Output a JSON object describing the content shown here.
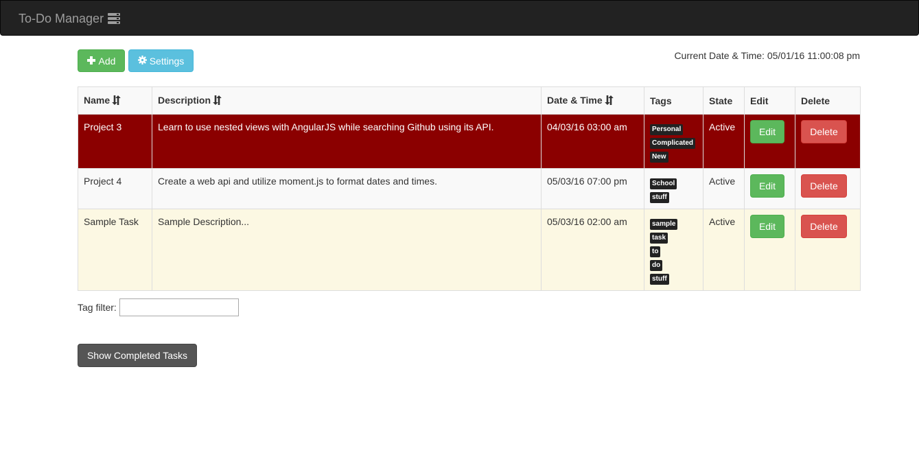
{
  "navbar": {
    "brand": "To-Do Manager",
    "brand_icon": "list-icon",
    "bg": "#222222"
  },
  "toolbar": {
    "add_label": "Add",
    "add_icon": "plus-icon",
    "settings_label": "Settings",
    "settings_icon": "gear-icon",
    "current_datetime": "Current Date & Time: 05/01/16 11:00:08 pm"
  },
  "table": {
    "headers": {
      "name": "Name",
      "description": "Description",
      "datetime": "Date & Time",
      "tags": "Tags",
      "state": "State",
      "edit": "Edit",
      "delete": "Delete"
    },
    "rows": [
      {
        "name": "Project 3",
        "description": "Learn to use nested views with AngularJS while searching Github using its API.",
        "datetime": "04/03/16 03:00 am",
        "tags": [
          "Personal",
          "Complicated",
          "New"
        ],
        "state": "Active",
        "edit_label": "Edit",
        "delete_label": "Delete",
        "highlight": "#8b0000"
      },
      {
        "name": "Project 4",
        "description": "Create a web api and utilize moment.js to format dates and times.",
        "datetime": "05/03/16 07:00 pm",
        "tags": [
          "School",
          "stuff"
        ],
        "state": "Active",
        "edit_label": "Edit",
        "delete_label": "Delete",
        "highlight": "#f9f9f9"
      },
      {
        "name": "Sample Task",
        "description": "Sample Description...",
        "datetime": "05/03/16 02:00 am",
        "tags": [
          "sample",
          "task",
          "to",
          "do",
          "stuff"
        ],
        "state": "Active",
        "edit_label": "Edit",
        "delete_label": "Delete",
        "highlight": "#fcf8e3"
      }
    ]
  },
  "filter": {
    "label": "Tag filter:",
    "value": "",
    "placeholder": ""
  },
  "show_completed_label": "Show Completed Tasks",
  "colors": {
    "success": "#5cb85c",
    "info": "#5bc0de",
    "danger": "#d9534f",
    "dark": "#555555"
  }
}
